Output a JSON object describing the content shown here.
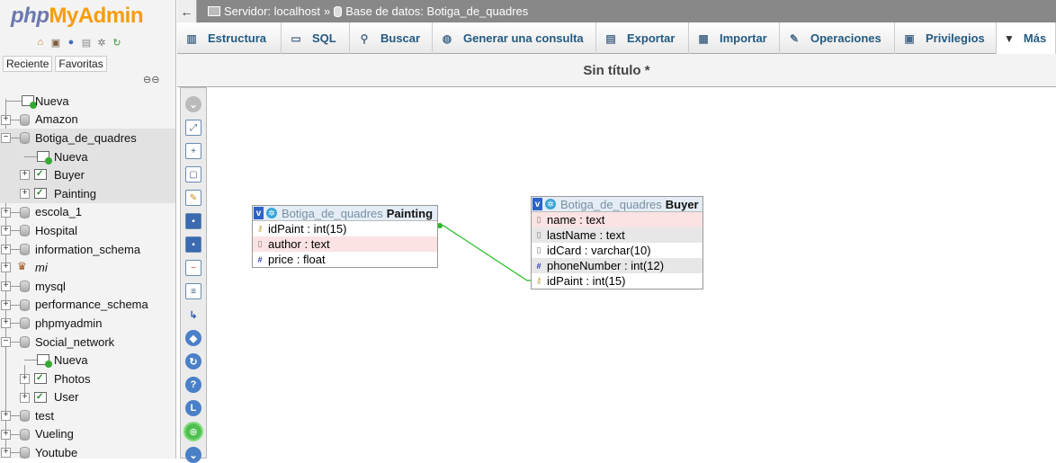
{
  "logo": {
    "php": "php",
    "my": "MyAdmin"
  },
  "nav_icons": [
    "home-icon",
    "logout-icon",
    "help-icon",
    "docs-icon",
    "settings-icon",
    "reload-icon"
  ],
  "nav_tabs": {
    "recent": "Reciente",
    "favorites": "Favoritas"
  },
  "tree": {
    "new": "Nueva",
    "amazon": "Amazon",
    "botiga": "Botiga_de_quadres",
    "botiga_new": "Nueva",
    "buyer": "Buyer",
    "painting": "Painting",
    "escola": "escola_1",
    "hospital": "Hospital",
    "info_schema": "information_schema",
    "mi": "mi",
    "mysql": "mysql",
    "perf_schema": "performance_schema",
    "phpmyadmin": "phpmyadmin",
    "social": "Social_network",
    "social_new": "Nueva",
    "photos": "Photos",
    "user": "User",
    "test": "test",
    "vueling": "Vueling",
    "youtube": "Youtube"
  },
  "breadcrumb": {
    "server": "Servidor: localhost",
    "separator": "»",
    "database": "Base de datos: Botiga_de_quadres"
  },
  "tabs": {
    "structure": "Estructura",
    "sql": "SQL",
    "search": "Buscar",
    "query": "Generar una consulta",
    "export": "Exportar",
    "import": "Importar",
    "operations": "Operaciones",
    "privileges": "Privilegios",
    "more": "Más"
  },
  "designer": {
    "title": "Sin título *"
  },
  "tables": {
    "painting": {
      "db": "Botiga_de_quadres",
      "name": "Painting",
      "fields": [
        {
          "label": "idPaint : int(15)",
          "icon": "key"
        },
        {
          "label": "author : text",
          "icon": "column"
        },
        {
          "label": "price : float",
          "icon": "hash"
        }
      ]
    },
    "buyer": {
      "db": "Botiga_de_quadres",
      "name": "Buyer",
      "fields": [
        {
          "label": "name : text",
          "icon": "column"
        },
        {
          "label": "lastName : text",
          "icon": "column"
        },
        {
          "label": "idCard : varchar(10)",
          "icon": "column"
        },
        {
          "label": "phoneNumber : int(12)",
          "icon": "hash"
        },
        {
          "label": "idPaint : int(15)",
          "icon": "key"
        }
      ]
    }
  },
  "colors": {
    "relation_line": "#22bb22",
    "logo_php": "#6c78af",
    "logo_myadmin": "#f89c0e",
    "breadcrumb_bg": "#888888",
    "tab_text": "#235a81"
  }
}
